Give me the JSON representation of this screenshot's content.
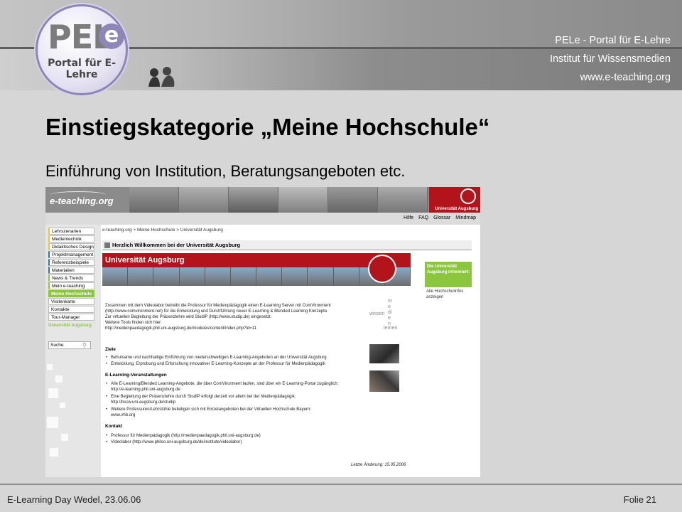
{
  "header": {
    "logo_text": "PEL",
    "logo_e": "e",
    "logo_subtitle": "Portal für E-Lehre",
    "lines": [
      "PELe - Portal für E-Lehre",
      "Institut für Wissensmedien",
      "www.e-teaching.org"
    ]
  },
  "slide": {
    "title": "Einstiegskategorie „Meine Hochschule“",
    "subtitle": "Einführung von Institution, Beratungsangeboten etc."
  },
  "screenshot": {
    "site_name": "e-teaching.org",
    "uni_name_short": "Universität Augsburg",
    "top_links": [
      "Hilfe",
      "FAQ",
      "Glossar",
      "Mindmap"
    ],
    "sidebar": [
      {
        "label": "Lehrszenarien",
        "green": false
      },
      {
        "label": "Medientechnik",
        "green": false
      },
      {
        "label": "Didaktisches Design",
        "green": false
      },
      {
        "label": "Projektmanagement",
        "green": false
      },
      {
        "label": "Referenzbeispiele",
        "green": false
      },
      {
        "label": "Materialien",
        "green": false
      },
      {
        "label": "News & Trends",
        "green": false
      },
      {
        "label": "Mein e-teaching",
        "green": false
      },
      {
        "label": "Meine Hochschule",
        "green": true
      },
      {
        "label": "Visitenkarte",
        "green": false
      },
      {
        "label": "Kontakte",
        "green": false
      },
      {
        "label": "Tour-Manager",
        "green": false
      }
    ],
    "sidebar_selection": "Universität Augsburg",
    "search_placeholder": "Suche",
    "breadcrumb": "e-teaching.org > Meine Hochschule > Universität Augsburg",
    "welcome": "Herzlich Willkommen bei der Universität Augsburg",
    "banner_name": "Universität Augsburg",
    "green_box": "Die Universität Augsburg informiert:",
    "green_link": "Alle Hochschulinfos anzeigen",
    "intro": [
      "Zusammen mit dem Videolabor betreibt die Professur für Medienpädagogik einen E-Learning Server mit ComVironment",
      "(http://www.comvironment.net) für die Entwicklung und Durchführung neuer E-Learning & Blended Learning Konzepte.",
      "Zur virtuellen Begleitung der Präsenzlehre wird StudIP (http://www.studip.de) eingesetzt.",
      "Weitere Tools finden sich hier:",
      "http://medienpaedagogik.phil.uni-augsburg.de/modules/content/index.php?id=11"
    ],
    "sections": [
      {
        "heading": "Ziele",
        "items": [
          "Behutsame und nachhaltige Einführung von niederschwelligen E-Learning-Angeboten an der Universität Augsburg",
          "Entwicklung, Erprobung und Erforschung innovativer E-Learning-Konzepte an der Professur für Medienpädagogik"
        ]
      },
      {
        "heading": "E-Learning-Veranstaltungen",
        "items": [
          "Alle E-Learning/Blended Learning-Angebote, die über ComVironment laufen, sind über ein E-Learning-Portal zugänglich:",
          "http://e-learning.phil.uni-augsburg.de",
          "Eine Begleitung der Präsenzlehre durch StudIP erfolgt derzeit vor allem bei der Medienpädagogik:",
          "http://bscw.uni-augsburg.de/studip",
          "Weitere Professuren/Lehrstühle beteiligen sich mit Einzelangeboten bei der Virtuellen Hochschule Bayern:",
          "www.vhb.org"
        ]
      },
      {
        "heading": "Kontakt",
        "items": [
          "Professur für Medienpädagogik (http://medienpaedagogik.phil.uni-augsburg.de)",
          "Videolabor (http://www.philso.uni-augsburg.de/de/institute/videolabor)"
        ]
      }
    ],
    "last_update": "Letzte Änderung: 15.05.2006",
    "wissen": [
      "wissen",
      "medien",
      "lernen"
    ]
  },
  "footer": {
    "left": "E-Learning Day Wedel, 23.06.06",
    "right": "Folie 21"
  }
}
